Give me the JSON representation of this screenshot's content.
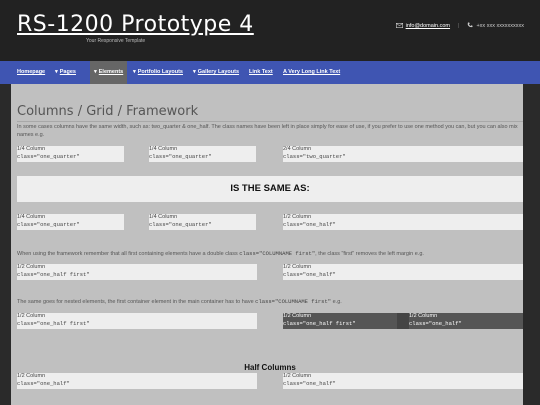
{
  "header": {
    "logo": "RS-1200 Prototype 4",
    "tagline": "Your Responsive Template",
    "email": "info@domain.com",
    "phone": "+xx xxx xxxxxxxxxx"
  },
  "nav": {
    "items": [
      {
        "label": "Homepage",
        "bullet": ""
      },
      {
        "label": "Pages",
        "bullet": "▾"
      },
      {
        "label": "Elements",
        "bullet": "▾"
      },
      {
        "label": "Portfolio Layouts",
        "bullet": "▾"
      },
      {
        "label": "Gallery Layouts",
        "bullet": "▾"
      },
      {
        "label": "Link Text",
        "bullet": ""
      },
      {
        "label": "A Very Long Link Text",
        "bullet": ""
      }
    ],
    "active": "Elements"
  },
  "main": {
    "title": "Columns / Grid / Framework",
    "intro": "In some cases columns have the same width, such as: two_quarter & one_half. The class names have been left in place simply for ease of use, if you prefer to use one method you can, but you can also mix names e.g.",
    "row1": [
      {
        "label": "1/4 Column",
        "cls": "class=\"one_quarter\""
      },
      {
        "label": "1/4 Column",
        "cls": "class=\"one_quarter\""
      },
      {
        "label": "2/4 Column",
        "cls": "class=\"two_quarter\""
      }
    ],
    "same_as": "IS THE SAME AS:",
    "row2": [
      {
        "label": "1/4 Column",
        "cls": "class=\"one_quarter\""
      },
      {
        "label": "1/4 Column",
        "cls": "class=\"one_quarter\""
      },
      {
        "label": "1/2 Column",
        "cls": "class=\"one_half\""
      }
    ],
    "para2_a": "When using the framework remember that all first containing elements have a double class ",
    "para2_code": "class=\"COLUMNAME first\"",
    "para2_b": ", the class \"first\" removes the left margin e.g.",
    "row3": [
      {
        "label": "1/2 Column",
        "cls": "class=\"one_half first\""
      },
      {
        "label": "1/2 Column",
        "cls": "class=\"one_half\""
      }
    ],
    "para3_a": "The same goes for nested elements, the first container element in the main container has to have ",
    "para3_code": "class=\"COLUMNAME first\"",
    "para3_b": " e.g.",
    "row4": [
      {
        "label": "1/2 Column",
        "cls": "class=\"one_half first\""
      },
      {
        "label": "1/2 Column",
        "cls": "class=\"one_half first\""
      },
      {
        "label": "1/2 Column",
        "cls": "class=\"one_half\""
      }
    ],
    "half_columns": "Half Columns",
    "row5": [
      {
        "label": "1/2 Column",
        "cls": "class=\"one_half\""
      },
      {
        "label": "1/2 Column",
        "cls": "class=\"one_half\""
      }
    ]
  },
  "colors": {
    "header_bg": "#222222",
    "nav_bg": "#3f55b2",
    "nav_active": "#666666",
    "content_bg": "#c0c0c0",
    "box_bg": "#eeeeee"
  }
}
